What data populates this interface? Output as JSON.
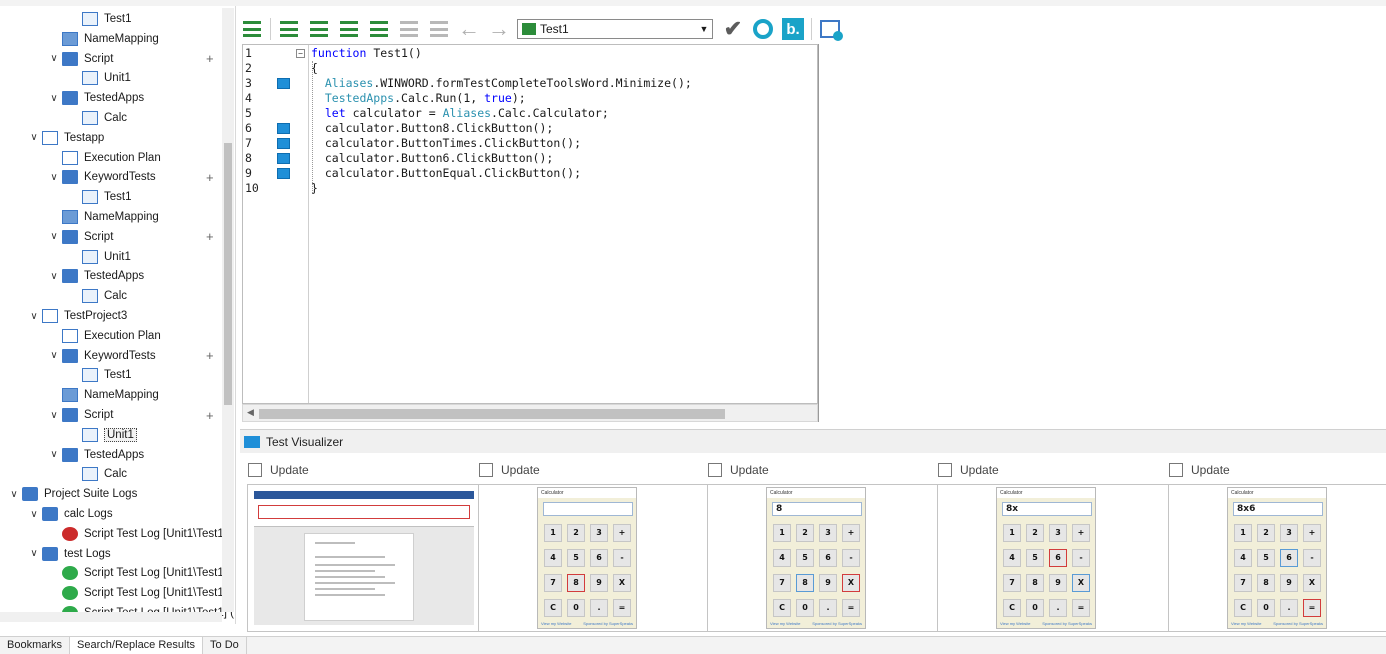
{
  "tree": {
    "items": [
      {
        "label": "Test1",
        "icon": "keyword-test-icon",
        "level": 3,
        "chevron": "",
        "plus": false
      },
      {
        "label": "NameMapping",
        "icon": "namemapping-icon",
        "level": 2,
        "chevron": "",
        "plus": false
      },
      {
        "label": "Script",
        "icon": "script-folder-icon",
        "level": 2,
        "chevron": "v",
        "plus": true
      },
      {
        "label": "Unit1",
        "icon": "unit-file-icon",
        "level": 3,
        "chevron": "",
        "plus": false
      },
      {
        "label": "TestedApps",
        "icon": "tested-apps-icon",
        "level": 2,
        "chevron": "v",
        "plus": false
      },
      {
        "label": "Calc",
        "icon": "calc-app-icon",
        "level": 3,
        "chevron": "",
        "plus": false
      },
      {
        "label": "Testapp",
        "icon": "project-icon",
        "level": 1,
        "chevron": "v",
        "plus": false
      },
      {
        "label": "Execution Plan",
        "icon": "execution-plan-icon",
        "level": 2,
        "chevron": "",
        "plus": false
      },
      {
        "label": "KeywordTests",
        "icon": "keyword-tests-icon",
        "level": 2,
        "chevron": "v",
        "plus": true
      },
      {
        "label": "Test1",
        "icon": "keyword-test-icon",
        "level": 3,
        "chevron": "",
        "plus": false
      },
      {
        "label": "NameMapping",
        "icon": "namemapping-icon",
        "level": 2,
        "chevron": "",
        "plus": false
      },
      {
        "label": "Script",
        "icon": "script-folder-icon",
        "level": 2,
        "chevron": "v",
        "plus": true
      },
      {
        "label": "Unit1",
        "icon": "unit-file-icon",
        "level": 3,
        "chevron": "",
        "plus": false
      },
      {
        "label": "TestedApps",
        "icon": "tested-apps-icon",
        "level": 2,
        "chevron": "v",
        "plus": false
      },
      {
        "label": "Calc",
        "icon": "calc-app-icon",
        "level": 3,
        "chevron": "",
        "plus": false
      },
      {
        "label": "TestProject3",
        "icon": "project-icon",
        "level": 1,
        "chevron": "v",
        "plus": false
      },
      {
        "label": "Execution Plan",
        "icon": "execution-plan-icon",
        "level": 2,
        "chevron": "",
        "plus": false
      },
      {
        "label": "KeywordTests",
        "icon": "keyword-tests-icon",
        "level": 2,
        "chevron": "v",
        "plus": true
      },
      {
        "label": "Test1",
        "icon": "keyword-test-icon",
        "level": 3,
        "chevron": "",
        "plus": false
      },
      {
        "label": "NameMapping",
        "icon": "namemapping-icon",
        "level": 2,
        "chevron": "",
        "plus": false
      },
      {
        "label": "Script",
        "icon": "script-folder-icon",
        "level": 2,
        "chevron": "v",
        "plus": true
      },
      {
        "label": "Unit1",
        "icon": "unit-file-icon",
        "level": 3,
        "chevron": "",
        "plus": false,
        "selected": true
      },
      {
        "label": "TestedApps",
        "icon": "tested-apps-icon",
        "level": 2,
        "chevron": "v",
        "plus": false
      },
      {
        "label": "Calc",
        "icon": "calc-app-icon",
        "level": 3,
        "chevron": "",
        "plus": false
      },
      {
        "label": "Project Suite Logs",
        "icon": "suite-logs-icon",
        "level": 0,
        "chevron": "v",
        "plus": false
      },
      {
        "label": "calc Logs",
        "icon": "logs-folder-icon",
        "level": 1,
        "chevron": "v",
        "plus": false
      },
      {
        "label": "Script Test Log [Unit1\\Test1] (",
        "icon": "log-error-icon",
        "level": 2,
        "chevron": "",
        "plus": false
      },
      {
        "label": "test Logs",
        "icon": "logs-folder-icon",
        "level": 1,
        "chevron": "v",
        "plus": false
      },
      {
        "label": "Script Test Log [Unit1\\Test1] (",
        "icon": "log-success-icon",
        "level": 2,
        "chevron": "",
        "plus": false
      },
      {
        "label": "Script Test Log [Unit1\\Test1] (",
        "icon": "log-success-icon",
        "level": 2,
        "chevron": "",
        "plus": false
      },
      {
        "label": "Script Test Log [Unit1\\Test1] (",
        "icon": "log-success-icon",
        "level": 2,
        "chevron": "",
        "plus": false
      }
    ]
  },
  "bottom_tabs": [
    "Bookmarks",
    "Search/Replace Results",
    "To Do"
  ],
  "toolbar": {
    "selected_test": "Test1"
  },
  "editor": {
    "line_numbers": [
      "1",
      "2",
      "3",
      "4",
      "5",
      "6",
      "7",
      "8",
      "9",
      "10"
    ],
    "lines": [
      [
        {
          "t": "function ",
          "c": "kw"
        },
        {
          "t": "Test1()",
          "c": "pl"
        }
      ],
      [
        {
          "t": "{",
          "c": "pl"
        }
      ],
      [
        {
          "t": "  Aliases",
          "c": "al"
        },
        {
          "t": ".WINWORD.formTestCompleteToolsWord.Minimize();",
          "c": "pl"
        }
      ],
      [
        {
          "t": "  TestedApps",
          "c": "al"
        },
        {
          "t": ".Calc.Run(1, ",
          "c": "pl"
        },
        {
          "t": "true",
          "c": "kw"
        },
        {
          "t": ");",
          "c": "pl"
        }
      ],
      [
        {
          "t": "  ",
          "c": "pl"
        },
        {
          "t": "let",
          "c": "kw"
        },
        {
          "t": " calculator = ",
          "c": "pl"
        },
        {
          "t": "Aliases",
          "c": "al"
        },
        {
          "t": ".Calc.Calculator;",
          "c": "pl"
        }
      ],
      [
        {
          "t": "  calculator.Button8.ClickButton();",
          "c": "pl"
        }
      ],
      [
        {
          "t": "  calculator.ButtonTimes.ClickButton();",
          "c": "pl"
        }
      ],
      [
        {
          "t": "  calculator.Button6.ClickButton();",
          "c": "pl"
        }
      ],
      [
        {
          "t": "  calculator.ButtonEqual.ClickButton();",
          "c": "pl"
        }
      ],
      [
        {
          "t": "}",
          "c": "pl"
        }
      ]
    ]
  },
  "visualizer": {
    "title": "Test Visualizer",
    "update_label": "Update",
    "frames": [
      {
        "kind": "word"
      },
      {
        "kind": "calc",
        "display": "",
        "hot": "8",
        "pressed": ""
      },
      {
        "kind": "calc",
        "display": "8",
        "hot": "X",
        "pressed": "8"
      },
      {
        "kind": "calc",
        "display": "8x",
        "hot": "6",
        "pressed": "X"
      },
      {
        "kind": "calc",
        "display": "8x6",
        "hot": "=",
        "pressed": "6"
      }
    ],
    "calc_title": "Calculator",
    "calc_keys": [
      [
        "1",
        "2",
        "3",
        "+"
      ],
      [
        "4",
        "5",
        "6",
        "-"
      ],
      [
        "7",
        "8",
        "9",
        "X"
      ],
      [
        "C",
        "0",
        ".",
        "="
      ]
    ],
    "calc_side_keys": [
      "",
      "",
      "÷",
      ""
    ],
    "calc_footer_left": "View my Website",
    "calc_footer_right": "Sponsored by SuperSpeaks"
  },
  "colors": {
    "accent": "#1aa3c8",
    "keyword": "#0000ff",
    "alias": "#2b91af",
    "run_green": "#2c8c3a"
  }
}
